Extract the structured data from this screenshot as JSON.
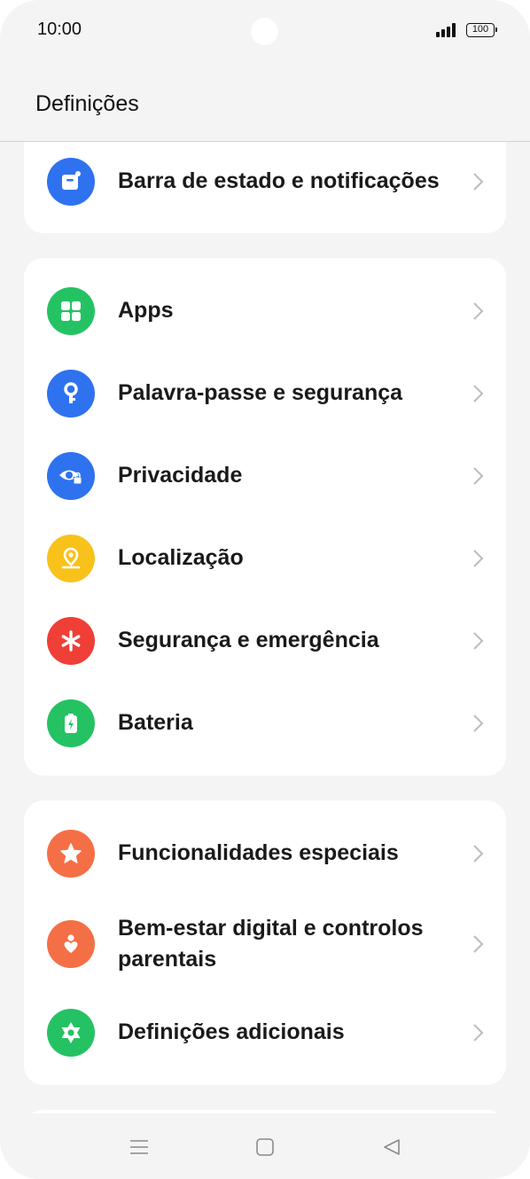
{
  "status_bar": {
    "time": "10:00",
    "battery_level": "100"
  },
  "header": {
    "title": "Definições"
  },
  "colors": {
    "blue": "#2f72f0",
    "green": "#25c263",
    "yellow": "#f8c21a",
    "red": "#ef3f37",
    "orange": "#f56f46"
  },
  "groups": [
    {
      "items": [
        {
          "label": "Barra de estado e notificações",
          "icon": "status-bar-icon",
          "color": "#2f72f0"
        }
      ]
    },
    {
      "items": [
        {
          "label": "Apps",
          "icon": "apps-icon",
          "color": "#25c263"
        },
        {
          "label": "Palavra-passe e segurança",
          "icon": "key-icon",
          "color": "#2f72f0"
        },
        {
          "label": "Privacidade",
          "icon": "privacy-eye-icon",
          "color": "#2f72f0"
        },
        {
          "label": "Localização",
          "icon": "location-icon",
          "color": "#f8c21a"
        },
        {
          "label": "Segurança e emergência",
          "icon": "asterisk-icon",
          "color": "#ef3f37"
        },
        {
          "label": "Bateria",
          "icon": "battery-icon",
          "color": "#25c263"
        }
      ]
    },
    {
      "items": [
        {
          "label": "Funcionalidades especiais",
          "icon": "star-icon",
          "color": "#f56f46"
        },
        {
          "label": "Bem-estar digital e controlos",
          "label_line2": "parentais",
          "icon": "wellbeing-icon",
          "color": "#f56f46"
        },
        {
          "label": "Definições adicionais",
          "icon": "gear-icon",
          "color": "#25c263"
        }
      ]
    }
  ],
  "nav_bar": {
    "icons": [
      "menu-icon",
      "home-icon",
      "back-icon"
    ]
  }
}
